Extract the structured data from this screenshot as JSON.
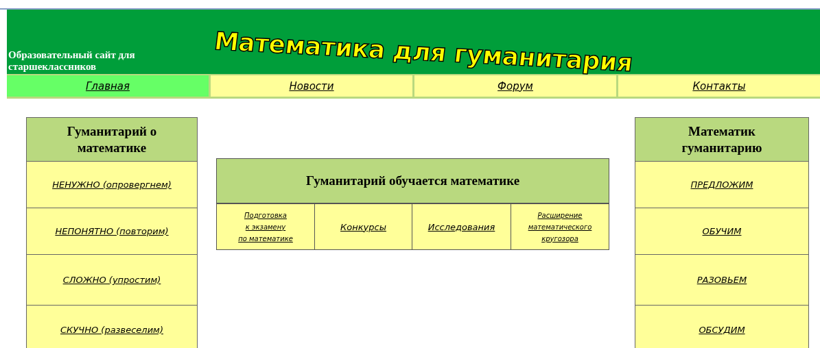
{
  "header": {
    "subtitle": "Образовательный сайт для старшеклассников",
    "title": "Математика для гуманитария"
  },
  "nav": [
    {
      "label": "Главная",
      "selected": true
    },
    {
      "label": "Новости",
      "selected": false
    },
    {
      "label": "Форум",
      "selected": false
    },
    {
      "label": "Контакты",
      "selected": false
    }
  ],
  "left_panel": {
    "heading": "Гуманитарий о математике",
    "links": [
      "НЕНУЖНО (опровергнем)",
      "НЕПОНЯТНО (повторим)",
      "СЛОЖНО (упростим)",
      "СКУЧНО (развеселим)"
    ]
  },
  "center_panel": {
    "heading": "Гуманитарий обучается математике",
    "links": [
      [
        "Подготовка",
        "к экзамену",
        "по математике"
      ],
      [
        "Конкурсы"
      ],
      [
        "Исследования"
      ],
      [
        "Расширение",
        "математического",
        "кругозора"
      ]
    ]
  },
  "right_panel": {
    "heading": "Математик гуманитарию",
    "links": [
      "ПРЕДЛОЖИМ",
      "ОБУЧИМ",
      "РАЗОВЬЕМ",
      "ОБСУДИМ"
    ]
  }
}
